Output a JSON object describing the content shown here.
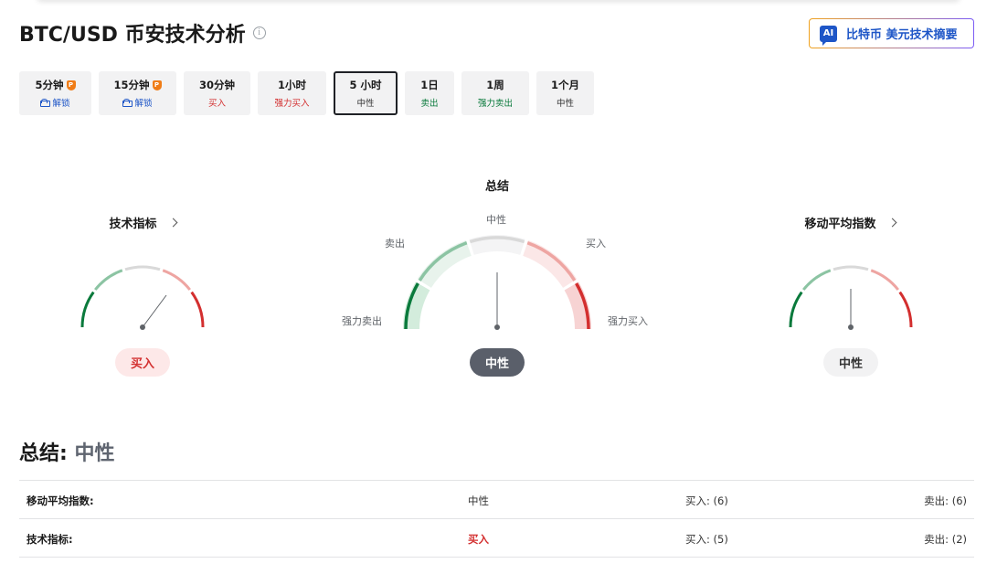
{
  "page": {
    "title": "BTC/USD 币安技术分析",
    "ai_button_badge": "AI",
    "ai_button_label": "比特币 美元技术摘要"
  },
  "tabs": [
    {
      "label": "5分钟",
      "sub": "解锁",
      "pro": "P",
      "locked": true,
      "color": "#1e56c7",
      "active": false
    },
    {
      "label": "15分钟",
      "sub": "解锁",
      "pro": "P",
      "locked": true,
      "color": "#1e56c7",
      "active": false
    },
    {
      "label": "30分钟",
      "sub": "买入",
      "locked": false,
      "color": "#d32f2f",
      "active": false
    },
    {
      "label": "1小时",
      "sub": "强力买入",
      "locked": false,
      "color": "#d32f2f",
      "active": false
    },
    {
      "label": "5 小时",
      "sub": "中性",
      "locked": false,
      "color": "#333333",
      "active": true
    },
    {
      "label": "1日",
      "sub": "卖出",
      "locked": false,
      "color": "#0a7a3c",
      "active": false
    },
    {
      "label": "1周",
      "sub": "强力卖出",
      "locked": false,
      "color": "#0a7a3c",
      "active": false
    },
    {
      "label": "1个月",
      "sub": "中性",
      "locked": false,
      "color": "#333333",
      "active": false
    }
  ],
  "gauges": {
    "technical": {
      "title": "技术指标",
      "result": "买入"
    },
    "summary": {
      "title": "总结",
      "result": "中性",
      "labels": {
        "neutral": "中性",
        "sell": "卖出",
        "buy": "买入",
        "strong_sell": "强力卖出",
        "strong_buy": "强力买入"
      }
    },
    "moving_avg": {
      "title": "移动平均指数",
      "result": "中性"
    }
  },
  "summary": {
    "label": "总结:",
    "value": "中性",
    "rows": [
      {
        "name": "移动平均指数:",
        "signal": "中性",
        "buy": "买入: (6)",
        "sell": "卖出: (6)"
      },
      {
        "name": "技术指标:",
        "signal": "买入",
        "buy": "买入: (5)",
        "sell": "卖出: (2)"
      }
    ]
  },
  "colors": {
    "strong_sell": "#0a7a3c",
    "sell": "#8cc4a3",
    "neutral": "#d9d9d9",
    "buy": "#eea5a2",
    "strong_buy": "#d32f2f",
    "accent": "#1e56c7"
  }
}
